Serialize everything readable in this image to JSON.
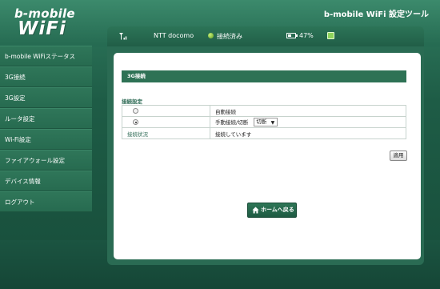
{
  "logo": {
    "brand": "b-mobile",
    "product": "WiFi"
  },
  "app_title": "b-mobile WiFi 設定ツール",
  "statusbar": {
    "carrier": "NTT docomo",
    "connection": "接続済み",
    "battery": "47%",
    "battery_level": 0.47
  },
  "sidebar": {
    "items": [
      {
        "label": "b-mobile WiFiステータス"
      },
      {
        "label": "3G接続"
      },
      {
        "label": "3G設定"
      },
      {
        "label": "ルータ設定"
      },
      {
        "label": "Wi-Fi設定"
      },
      {
        "label": "ファイアウォール設定"
      },
      {
        "label": "デバイス情報"
      },
      {
        "label": "ログアウト"
      }
    ]
  },
  "main": {
    "section_title": "3G接続",
    "settings_label": "接続設定",
    "rows": [
      {
        "option": "自動接続",
        "checked": false
      },
      {
        "option": "手動接続/切断",
        "checked": true,
        "select_value": "切断"
      }
    ],
    "status_label": "接続状況",
    "status_value": "接続しています",
    "apply_label": "適用",
    "home_label": "ホームへ戻る"
  }
}
